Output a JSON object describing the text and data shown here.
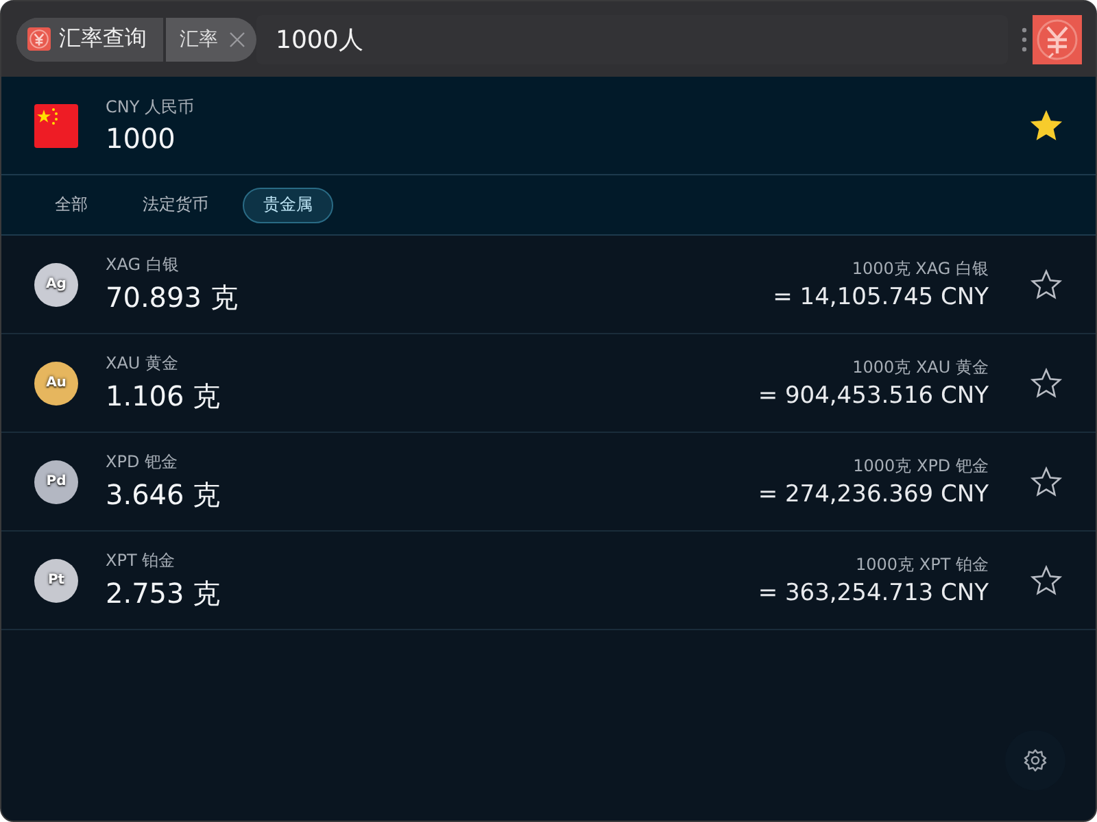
{
  "search": {
    "plugin": "汇率查询",
    "keyword": "汇率",
    "query": "1000人"
  },
  "base": {
    "code_name": "CNY 人民币",
    "amount": "1000",
    "favorite": true
  },
  "tabs": [
    {
      "label": "全部",
      "selected": false
    },
    {
      "label": "法定货币",
      "selected": false
    },
    {
      "label": "贵金属",
      "selected": true
    }
  ],
  "rows": [
    {
      "symbol": "Ag",
      "color": "#c9cbd3",
      "name": "XAG 白银",
      "amount": "70.893 克",
      "rate_label": "1000克 XAG 白银",
      "rate_value": "= 14,105.745 CNY",
      "favorite": false
    },
    {
      "symbol": "Au",
      "color": "#e6b65e",
      "name": "XAU 黄金",
      "amount": "1.106 克",
      "rate_label": "1000克 XAU 黄金",
      "rate_value": "= 904,453.516 CNY",
      "favorite": false
    },
    {
      "symbol": "Pd",
      "color": "#b3b7c2",
      "name": "XPD 钯金",
      "amount": "3.646 克",
      "rate_label": "1000克 XPD 钯金",
      "rate_value": "= 274,236.369 CNY",
      "favorite": false
    },
    {
      "symbol": "Pt",
      "color": "#c6c8cf",
      "name": "XPT 铂金",
      "amount": "2.753 克",
      "rate_label": "1000克 XPT 铂金",
      "rate_value": "= 363,254.713 CNY",
      "favorite": false
    }
  ]
}
